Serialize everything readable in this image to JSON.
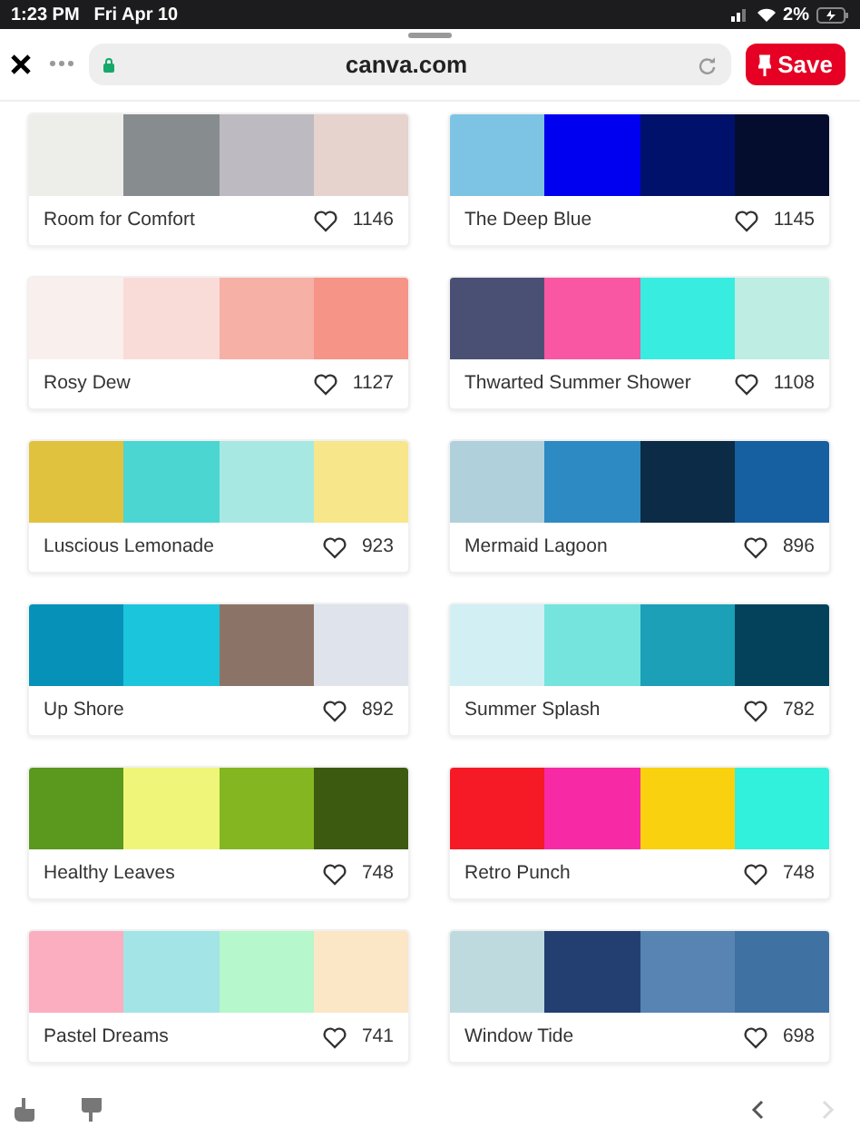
{
  "status_bar": {
    "time": "1:23 PM",
    "date": "Fri Apr 10",
    "battery": "2%"
  },
  "toolbar": {
    "url": "canva.com",
    "save_button": "Save"
  },
  "palettes": [
    {
      "name": "Room for Comfort",
      "likes": "1146",
      "swatches": [
        {
          "color": "#ededea"
        },
        {
          "color": "#878c8e"
        },
        {
          "color": "#bdbac1"
        },
        {
          "color": "#e6d3cd"
        }
      ]
    },
    {
      "name": "The Deep Blue",
      "likes": "1145",
      "swatches": [
        {
          "color": "#7dc4e4"
        },
        {
          "color": "#0000f0"
        },
        {
          "color": "#00116b"
        },
        {
          "color": "#050d2e"
        }
      ]
    },
    {
      "name": "Rosy Dew",
      "likes": "1127",
      "swatches": [
        {
          "color": "#f9efed"
        },
        {
          "color": "#f9dcd8"
        },
        {
          "color": "#f7b0a6"
        },
        {
          "color": "#f69487"
        }
      ]
    },
    {
      "name": "Thwarted Summer Shower",
      "likes": "1108",
      "swatches": [
        {
          "color": "#4a5073"
        },
        {
          "color": "#f957a3"
        },
        {
          "color": "#38ede0"
        },
        {
          "color": "#bdede3"
        }
      ]
    },
    {
      "name": "Luscious Lemonade",
      "likes": "923",
      "swatches": [
        {
          "color": "#e0c23e"
        },
        {
          "color": "#4cd6d1"
        },
        {
          "color": "#a8e8e2"
        },
        {
          "color": "#f8e68a"
        }
      ]
    },
    {
      "name": "Mermaid Lagoon",
      "likes": "896",
      "swatches": [
        {
          "color": "#b0d0dc"
        },
        {
          "color": "#2d8ac2"
        },
        {
          "color": "#0b2b46"
        },
        {
          "color": "#165fa0"
        }
      ]
    },
    {
      "name": "Up Shore",
      "likes": "892",
      "swatches": [
        {
          "color": "#0691b9"
        },
        {
          "color": "#1bc6dc"
        },
        {
          "color": "#8b7467"
        },
        {
          "color": "#dfe3ec"
        }
      ]
    },
    {
      "name": "Summer Splash",
      "likes": "782",
      "swatches": [
        {
          "color": "#d2eff3"
        },
        {
          "color": "#74e4dc"
        },
        {
          "color": "#1ba0b7"
        },
        {
          "color": "#03425a"
        }
      ]
    },
    {
      "name": "Healthy Leaves",
      "likes": "748",
      "swatches": [
        {
          "color": "#5a981e"
        },
        {
          "color": "#eef578"
        },
        {
          "color": "#84b622"
        },
        {
          "color": "#3c5a10"
        }
      ]
    },
    {
      "name": "Retro Punch",
      "likes": "748",
      "swatches": [
        {
          "color": "#f51a26"
        },
        {
          "color": "#f829a4"
        },
        {
          "color": "#f9d10f"
        },
        {
          "color": "#31f0dc"
        }
      ]
    },
    {
      "name": "Pastel Dreams",
      "likes": "741",
      "swatches": [
        {
          "color": "#fbaec0"
        },
        {
          "color": "#a3e4e6"
        },
        {
          "color": "#b6f7cb"
        },
        {
          "color": "#fbe6c6"
        }
      ]
    },
    {
      "name": "Window Tide",
      "likes": "698",
      "swatches": [
        {
          "color": "#bedade"
        },
        {
          "color": "#233f72"
        },
        {
          "color": "#5784b2"
        },
        {
          "color": "#3f72a3"
        }
      ]
    }
  ]
}
